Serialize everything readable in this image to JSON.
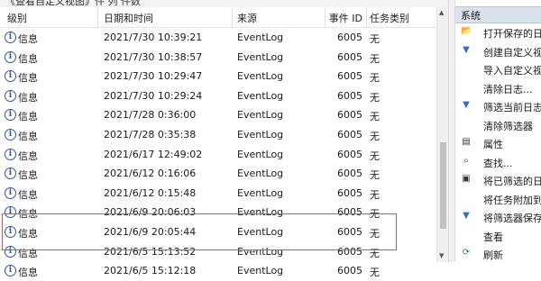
{
  "top_strip_text": "《查看自定义视图》件 列 件数",
  "columns": {
    "level": "级别",
    "datetime": "日期和时间",
    "source": "来源",
    "event_id": "事件 ID",
    "task": "任务类别"
  },
  "rows": [
    {
      "level": "信息",
      "datetime": "2021/7/30 10:39:21",
      "source": "EventLog",
      "event_id": "6005",
      "task": "无"
    },
    {
      "level": "信息",
      "datetime": "2021/7/30 10:38:57",
      "source": "EventLog",
      "event_id": "6005",
      "task": "无"
    },
    {
      "level": "信息",
      "datetime": "2021/7/30 10:29:47",
      "source": "EventLog",
      "event_id": "6005",
      "task": "无"
    },
    {
      "level": "信息",
      "datetime": "2021/7/30 10:29:24",
      "source": "EventLog",
      "event_id": "6005",
      "task": "无"
    },
    {
      "level": "信息",
      "datetime": "2021/7/28 0:36:00",
      "source": "EventLog",
      "event_id": "6005",
      "task": "无"
    },
    {
      "level": "信息",
      "datetime": "2021/7/28 0:35:38",
      "source": "EventLog",
      "event_id": "6005",
      "task": "无"
    },
    {
      "level": "信息",
      "datetime": "2021/6/17 12:49:02",
      "source": "EventLog",
      "event_id": "6005",
      "task": "无"
    },
    {
      "level": "信息",
      "datetime": "2021/6/12 0:16:06",
      "source": "EventLog",
      "event_id": "6005",
      "task": "无"
    },
    {
      "level": "信息",
      "datetime": "2021/6/12 0:15:48",
      "source": "EventLog",
      "event_id": "6005",
      "task": "无"
    },
    {
      "level": "信息",
      "datetime": "2021/6/9 20:06:03",
      "source": "EventLog",
      "event_id": "6005",
      "task": "无"
    },
    {
      "level": "信息",
      "datetime": "2021/6/9 20:05:44",
      "source": "EventLog",
      "event_id": "6005",
      "task": "无"
    },
    {
      "level": "信息",
      "datetime": "2021/6/5 15:13:52",
      "source": "EventLog",
      "event_id": "6005",
      "task": "无"
    },
    {
      "level": "信息",
      "datetime": "2021/6/5 15:12:18",
      "source": "EventLog",
      "event_id": "6005",
      "task": "无"
    }
  ],
  "actions": {
    "header": "系统",
    "items": [
      {
        "icon": "folder-open-icon",
        "glyph": "📂",
        "label": "打开保存的日志..."
      },
      {
        "icon": "create-view-filter-icon",
        "glyph": "▼",
        "label": "创建自定义视图..."
      },
      {
        "icon": "none",
        "glyph": "",
        "label": "导入自定义视图..."
      },
      {
        "icon": "none",
        "glyph": "",
        "label": "清除日志..."
      },
      {
        "icon": "filter-icon",
        "glyph": "▼",
        "label": "筛选当前日志..."
      },
      {
        "icon": "none",
        "glyph": "",
        "label": "清除筛选器"
      },
      {
        "icon": "properties-icon",
        "glyph": "▤",
        "label": "属性"
      },
      {
        "icon": "find-icon",
        "glyph": "⌕",
        "label": "查找..."
      },
      {
        "icon": "save-icon",
        "glyph": "▣",
        "label": "将已筛选的日志..."
      },
      {
        "icon": "none",
        "glyph": "",
        "label": "将任务附加到此..."
      },
      {
        "icon": "save-filter-icon",
        "glyph": "▼",
        "label": "将筛选器保存到..."
      },
      {
        "icon": "none",
        "glyph": "",
        "label": "查看"
      },
      {
        "icon": "refresh-icon",
        "glyph": "⟳",
        "label": "刷新"
      }
    ]
  }
}
